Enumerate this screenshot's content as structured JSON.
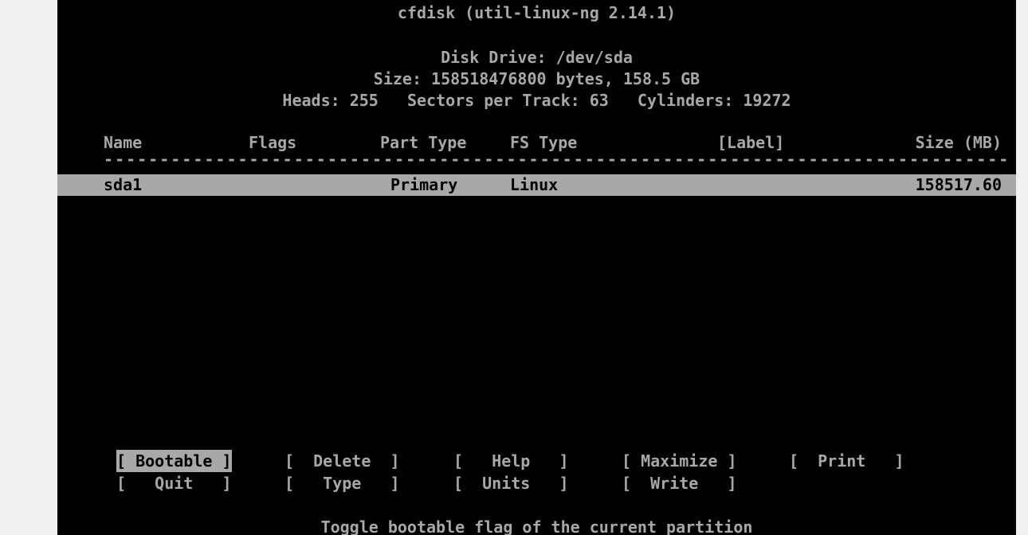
{
  "app": {
    "title": "cfdisk (util-linux-ng 2.14.1)"
  },
  "disk": {
    "drive": "Disk Drive: /dev/sda",
    "size": "Size: 158518476800 bytes, 158.5 GB",
    "geometry": "Heads: 255   Sectors per Track: 63   Cylinders: 19272"
  },
  "table": {
    "headers": {
      "name": "Name",
      "flags": "Flags",
      "part_type": "Part Type",
      "fs_type": "FS Type",
      "label": "[Label]",
      "size": "Size (MB)"
    },
    "rows": [
      {
        "name": "sda1",
        "flags": "",
        "part_type": "Primary",
        "fs_type": "Linux",
        "label": "",
        "size": "158517.60",
        "selected": true
      }
    ]
  },
  "menu": {
    "selected": "Bootable",
    "items": [
      "[ Bootable ]",
      "[  Delete  ]",
      "[   Help   ]",
      "[ Maximize ]",
      "[  Print   ]",
      "[   Quit   ]",
      "[   Type   ]",
      "[  Units   ]",
      "[  Write   ]"
    ]
  },
  "status": {
    "help_text": "Toggle bootable flag of the current partition"
  },
  "colors": {
    "background": "#000000",
    "foreground": "#a8a8a8",
    "highlight_bg": "#a8a8a8",
    "highlight_fg": "#000000",
    "page_margin": "#f0f0f0"
  }
}
